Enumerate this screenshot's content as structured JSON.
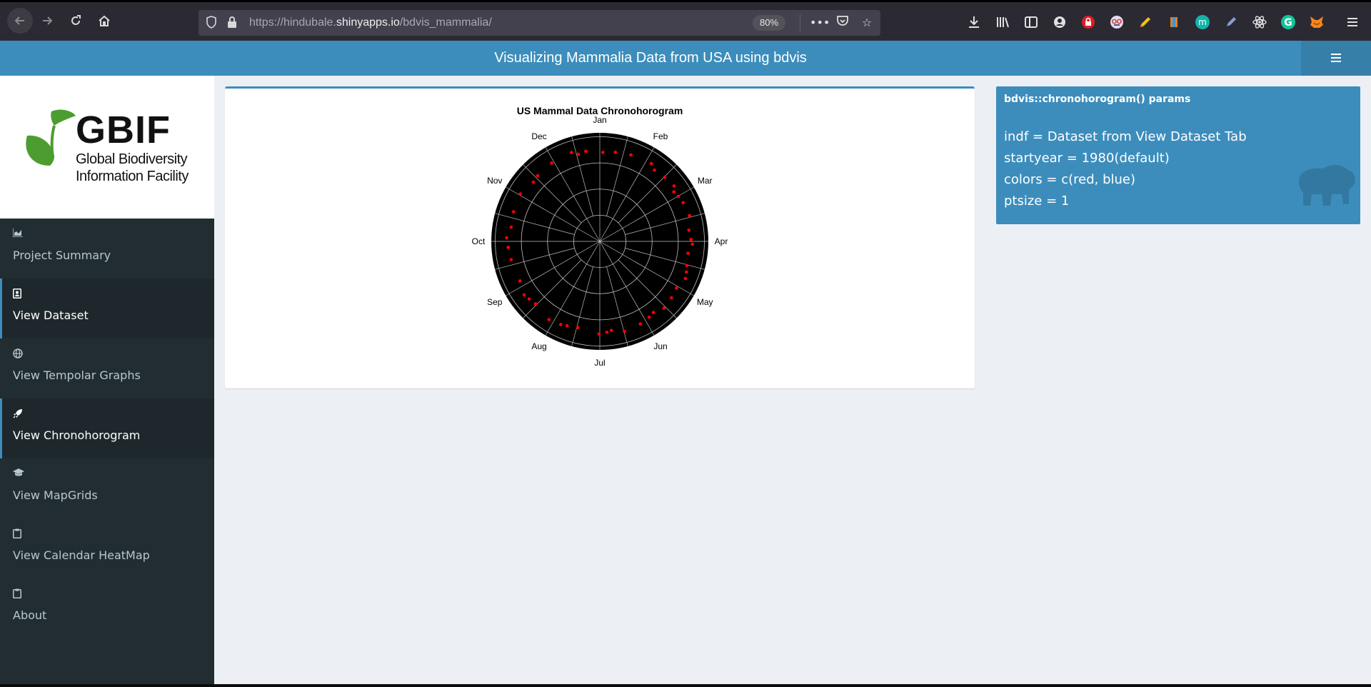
{
  "browser": {
    "url_prefix": "https://hindubale.",
    "url_host": "shinyapps.io",
    "url_path": "/bdvis_mammalia/",
    "zoom": "80%",
    "page_actions_icon": "ellipsis-icon",
    "pocket_icon": "pocket-icon",
    "bookmark_icon": "star-icon"
  },
  "header": {
    "title": "Visualizing Mammalia Data from USA using bdvis",
    "toggle_icon": "hamburger-icon"
  },
  "logo": {
    "name": "GBIF",
    "line1": "Global Biodiversity",
    "line2": "Information Facility"
  },
  "sidebar": {
    "items": [
      {
        "label": "Project Summary",
        "icon": "bar-chart-icon",
        "active": false
      },
      {
        "label": "View Dataset",
        "icon": "address-book-icon",
        "active": true
      },
      {
        "label": "View Tempolar Graphs",
        "icon": "globe-icon",
        "active": false
      },
      {
        "label": "View Chronohorogram",
        "icon": "rocket-icon",
        "active": true
      },
      {
        "label": "View MapGrids",
        "icon": "graduation-cap-icon",
        "active": false
      },
      {
        "label": "View Calendar HeatMap",
        "icon": "clipboard-icon",
        "active": false
      },
      {
        "label": "About",
        "icon": "clipboard-icon",
        "active": false
      }
    ]
  },
  "info_box": {
    "title": "bdvis::chronohorogram() params",
    "lines": [
      "indf = Dataset from View Dataset Tab",
      "startyear = 1980(default)",
      "colors = c(red, blue)",
      "ptsize = 1"
    ],
    "icon": "hippo-icon"
  },
  "colors": {
    "header_blue": "#3c8dbc",
    "sidebar_dark": "#222d32",
    "point_red": "#ff0000"
  },
  "chart_data": {
    "type": "scatter",
    "projection": "polar",
    "title": "US Mammal Data Chronohorogram",
    "month_labels": [
      "Jan",
      "Feb",
      "Mar",
      "Apr",
      "May",
      "Jun",
      "Jul",
      "Aug",
      "Sep",
      "Oct",
      "Nov",
      "Dec"
    ],
    "rings": 4,
    "spokes": 24,
    "background": "black",
    "grid_color": "#bfbfbf",
    "point_color": "#ff0000",
    "points_day_of_year": [
      2,
      10,
      20,
      34,
      38,
      46,
      54,
      57,
      61,
      66,
      75,
      84,
      90,
      93,
      99,
      107,
      111,
      115,
      123,
      130,
      138,
      145,
      149,
      156,
      167,
      175,
      178,
      183,
      197,
      204,
      208,
      216,
      229,
      234,
      238,
      247,
      262,
      270,
      276,
      283,
      293,
      305,
      316,
      321,
      333,
      347,
      351,
      356
    ]
  }
}
